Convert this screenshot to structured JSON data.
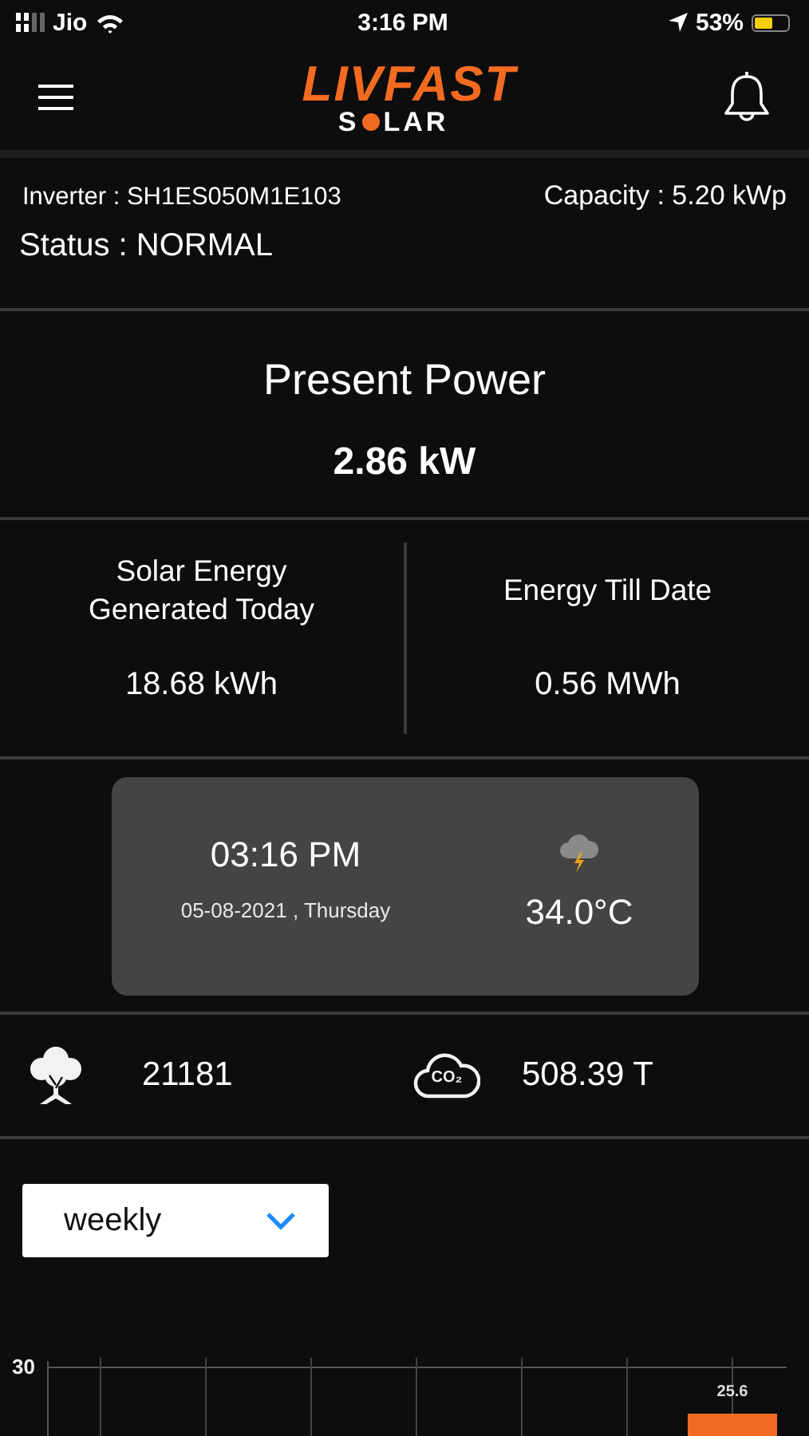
{
  "status_bar": {
    "carrier": "Jio",
    "time": "3:16 PM",
    "battery": "53%"
  },
  "header": {
    "brand": "LIVFAST",
    "sub_start": "S",
    "sub_end": "LAR"
  },
  "inverter": {
    "inverter": "Inverter : SH1ES050M1E103",
    "capacity": "Capacity : 5.20 kWp",
    "status": "Status : NORMAL"
  },
  "present_power": {
    "title": "Present Power",
    "value": "2.86 kW"
  },
  "energy": [
    {
      "title": "Solar Energy Generated Today",
      "value": "18.68 kWh"
    },
    {
      "title": "Energy Till Date",
      "value": "0.56 MWh"
    }
  ],
  "weather": {
    "time": "03:16 PM",
    "date": "05-08-2021 , Thursday",
    "temperature": "34.0°C"
  },
  "environment": [
    {
      "kind": "trees",
      "value": "21181"
    },
    {
      "kind": "co2",
      "icon_text": "CO₂",
      "value": "508.39 T"
    }
  ],
  "period_select": {
    "value": "weekly"
  },
  "chart": {
    "axis_label": "30",
    "bar_label": "25.6"
  }
}
